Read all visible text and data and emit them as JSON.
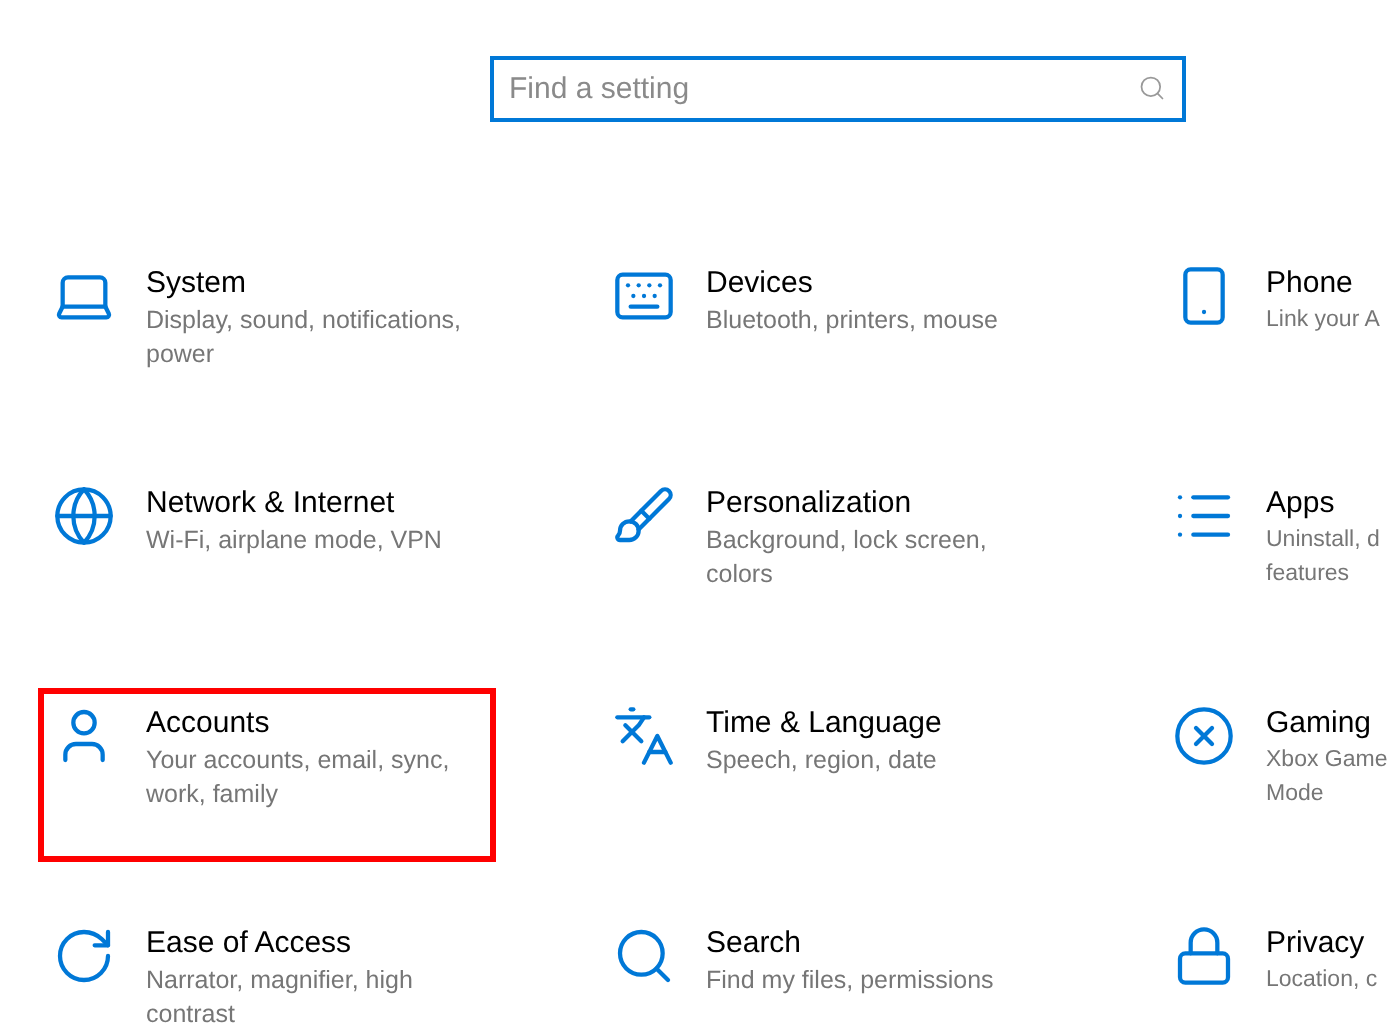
{
  "search": {
    "placeholder": "Find a setting"
  },
  "tiles": [
    {
      "title": "System",
      "description": "Display, sound, notifications, power",
      "selected": false
    },
    {
      "title": "Devices",
      "description": "Bluetooth, printers, mouse",
      "selected": false
    },
    {
      "title": "Phone",
      "description": "Link your A",
      "selected": false
    },
    {
      "title": "Network & Internet",
      "description": "Wi-Fi, airplane mode, VPN",
      "selected": false
    },
    {
      "title": "Personalization",
      "description": "Background, lock screen, colors",
      "selected": false
    },
    {
      "title": "Apps",
      "description": "Uninstall, d features",
      "selected": false
    },
    {
      "title": "Accounts",
      "description": "Your accounts, email, sync, work, family",
      "selected": true
    },
    {
      "title": "Time & Language",
      "description": "Speech, region, date",
      "selected": false
    },
    {
      "title": "Gaming",
      "description": "Xbox Game Mode",
      "selected": false
    },
    {
      "title": "Ease of Access",
      "description": "Narrator, magnifier, high contrast",
      "selected": false
    },
    {
      "title": "Search",
      "description": "Find my files, permissions",
      "selected": false
    },
    {
      "title": "Privacy",
      "description": "Location, c",
      "selected": false
    }
  ]
}
